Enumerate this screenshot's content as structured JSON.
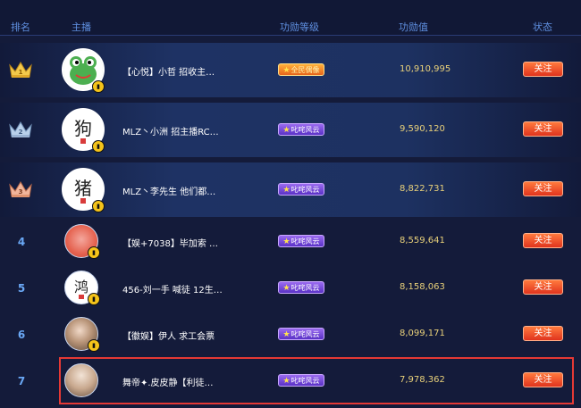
{
  "header": {
    "rank": "排名",
    "streamer": "主播",
    "level": "功勋等级",
    "value": "功勋值",
    "status": "状态"
  },
  "rows": [
    {
      "rank": "1",
      "name": "【心悦】小哲 招收主…",
      "level": "全民偶像",
      "level_color": "gold",
      "value": "10,910,995",
      "follow": "关注",
      "avatar": "frog",
      "avatar_text": ""
    },
    {
      "rank": "2",
      "name": "MLZ丶小洲 招主播RC…",
      "level": "叱咤风云",
      "level_color": "purple",
      "value": "9,590,120",
      "follow": "关注",
      "avatar": "calligraphy",
      "avatar_text": "狗"
    },
    {
      "rank": "3",
      "name": "MLZ丶李先生 他们都…",
      "level": "叱咤风云",
      "level_color": "purple",
      "value": "8,822,731",
      "follow": "关注",
      "avatar": "calligraphy",
      "avatar_text": "猪"
    },
    {
      "rank": "4",
      "name": "【娱+7038】毕加索 …",
      "level": "叱咤风云",
      "level_color": "purple",
      "value": "8,559,641",
      "follow": "关注",
      "avatar": "photo-red",
      "avatar_text": ""
    },
    {
      "rank": "5",
      "name": "456-刘一手 喊徒 12生…",
      "level": "叱咤风云",
      "level_color": "purple",
      "value": "8,158,063",
      "follow": "关注",
      "avatar": "calligraphy",
      "avatar_text": "鸿"
    },
    {
      "rank": "6",
      "name": "【徽娱】伊人 求工会票",
      "level": "叱咤风云",
      "level_color": "purple",
      "value": "8,099,171",
      "follow": "关注",
      "avatar": "photo-girl",
      "avatar_text": ""
    },
    {
      "rank": "7",
      "name": "舞帝✦.皮皮静【利徒…",
      "level": "叱咤风云",
      "level_color": "purple",
      "value": "7,978,362",
      "follow": "关注",
      "avatar": "photo-person",
      "avatar_text": ""
    }
  ],
  "colors": {
    "background": "#141b3a",
    "accent_blue": "#5f8fe0",
    "value_gold": "#e8d07a",
    "follow_orange": "#e0341e",
    "highlight_red": "#e53935"
  }
}
